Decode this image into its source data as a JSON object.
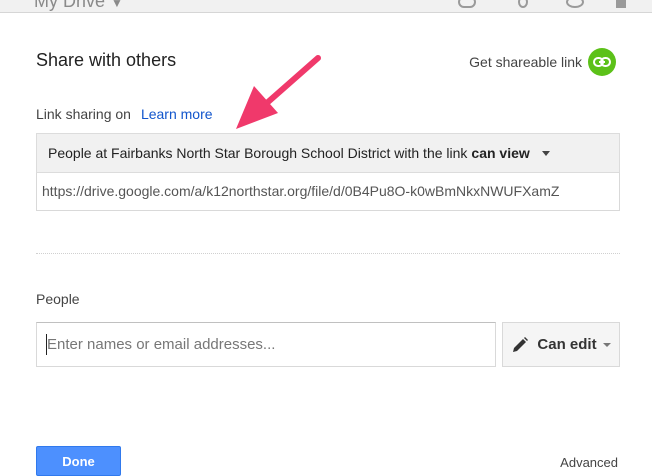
{
  "background": {
    "title": "My Drive"
  },
  "dialog": {
    "title": "Share with others",
    "get_link_label": "Get shareable link",
    "link_sharing_label": "Link sharing on",
    "learn_more": "Learn more",
    "access": {
      "prefix": "People at Fairbanks North Star Borough School District with the link",
      "permission": "can view"
    },
    "link_url": "https://drive.google.com/a/k12northstar.org/file/d/0B4Pu8O-k0wBmNkxNWUFXamZ",
    "people_label": "People",
    "people_input": {
      "value": "",
      "placeholder": "Enter names or email addresses..."
    },
    "permission_button": "Can edit",
    "done_button": "Done",
    "advanced_link": "Advanced"
  },
  "colors": {
    "accent_blue": "#4d90fe",
    "link_blue": "#1155cc",
    "link_icon_green": "#5cc119",
    "annotation_arrow": "#f0396b"
  },
  "icons": {
    "get_link": "link-icon",
    "permission": "pencil-icon",
    "dropdown": "caret-down-icon",
    "annotation": "arrow-icon"
  }
}
